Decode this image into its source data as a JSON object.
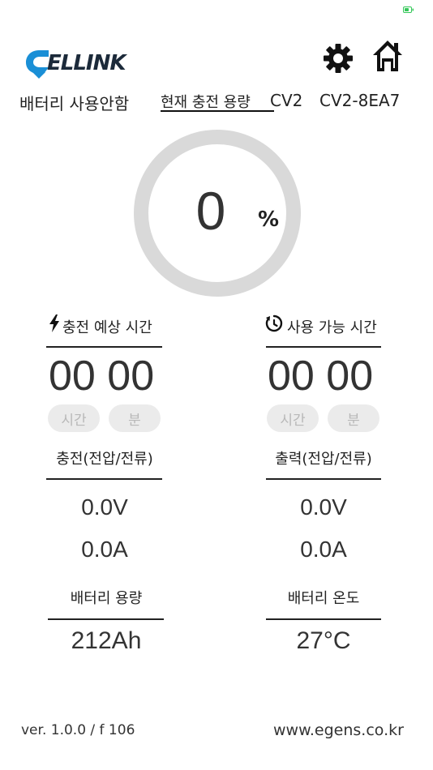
{
  "status_bar": {
    "battery_color": "#34c759"
  },
  "header": {
    "logo_text": "CELLINK",
    "icons": [
      "gear-icon",
      "home-icon"
    ]
  },
  "status": {
    "battery_state": "배터리 사용안함",
    "capacity_label": "현재 충전 용량",
    "capacity_cv": "CV2",
    "device_id": "CV2-8EA7"
  },
  "gauge": {
    "value": "0",
    "unit": "%",
    "fill_fraction": 0,
    "track_color": "#d9d9d9"
  },
  "charge": {
    "time_title": "충전 예상 시간",
    "time_value": "00 00",
    "hour_label": "시간",
    "minute_label": "분",
    "section_title": "충전(전압/전류)",
    "voltage": "0.0V",
    "current": "0.0A",
    "capacity_title": "배터리 용량",
    "capacity_value": "212Ah"
  },
  "usage": {
    "time_title": "사용 가능 시간",
    "time_value": "00 00",
    "hour_label": "시간",
    "minute_label": "분",
    "section_title": "출력(전압/전류)",
    "voltage": "0.0V",
    "current": "0.0A",
    "temp_title": "배터리 온도",
    "temp_value": "27°C"
  },
  "footer": {
    "version": "ver. 1.0.0 / f 106",
    "website": "www.egens.co.kr"
  }
}
